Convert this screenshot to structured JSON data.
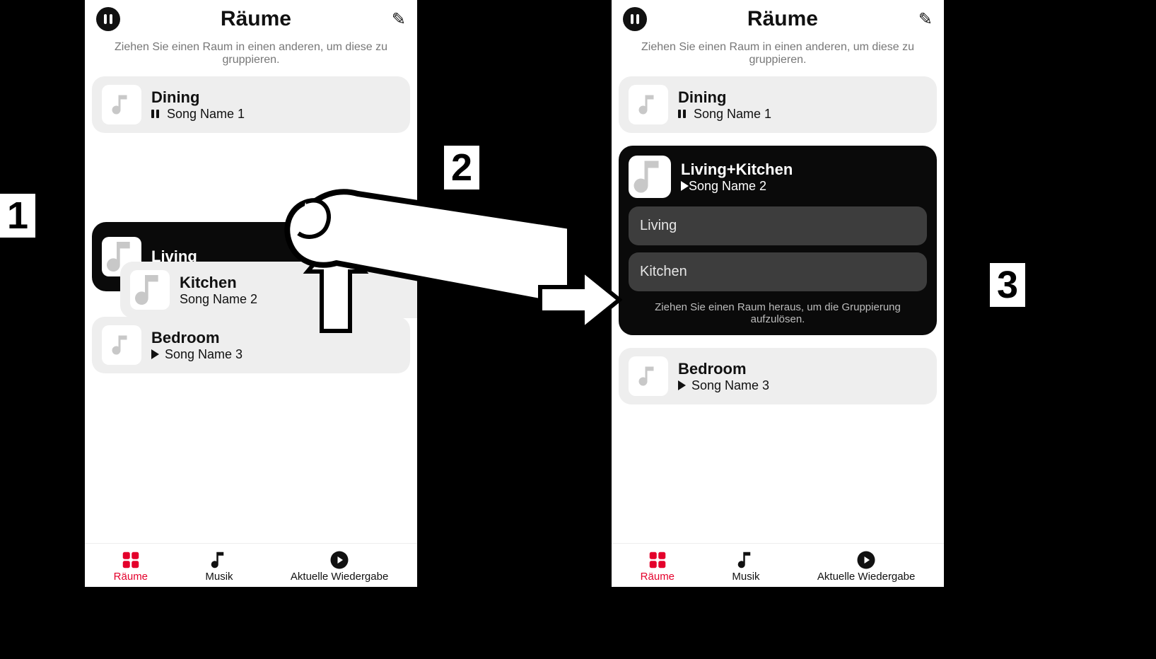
{
  "header": {
    "title": "Räume",
    "subhead": "Ziehen Sie einen Raum in einen anderen, um diese zu gruppieren."
  },
  "left_screen": {
    "rooms": [
      {
        "name": "Dining",
        "song": "Song Name 1",
        "state": "pause"
      },
      {
        "name": "Living",
        "song": "",
        "state": "play"
      },
      {
        "name": "Kitchen",
        "song": "Song Name 2",
        "state": "stop"
      },
      {
        "name": "Bedroom",
        "song": "Song Name 3",
        "state": "play"
      }
    ]
  },
  "right_screen": {
    "rooms_top": {
      "name": "Dining",
      "song": "Song Name 1",
      "state": "pause"
    },
    "group": {
      "name": "Living+Kitchen",
      "song": "Song Name 2",
      "state": "play",
      "members": [
        "Living",
        "Kitchen"
      ],
      "hint": "Ziehen Sie einen Raum heraus, um die Gruppierung aufzulösen."
    },
    "rooms_after": {
      "name": "Bedroom",
      "song": "Song Name 3",
      "state": "play"
    }
  },
  "tabs": {
    "rooms": "Räume",
    "music": "Musik",
    "nowplay": "Aktuelle Wiedergabe"
  },
  "steps": {
    "s1": "1",
    "s2": "2",
    "s3": "3"
  },
  "colors": {
    "accent": "#e4002b"
  }
}
